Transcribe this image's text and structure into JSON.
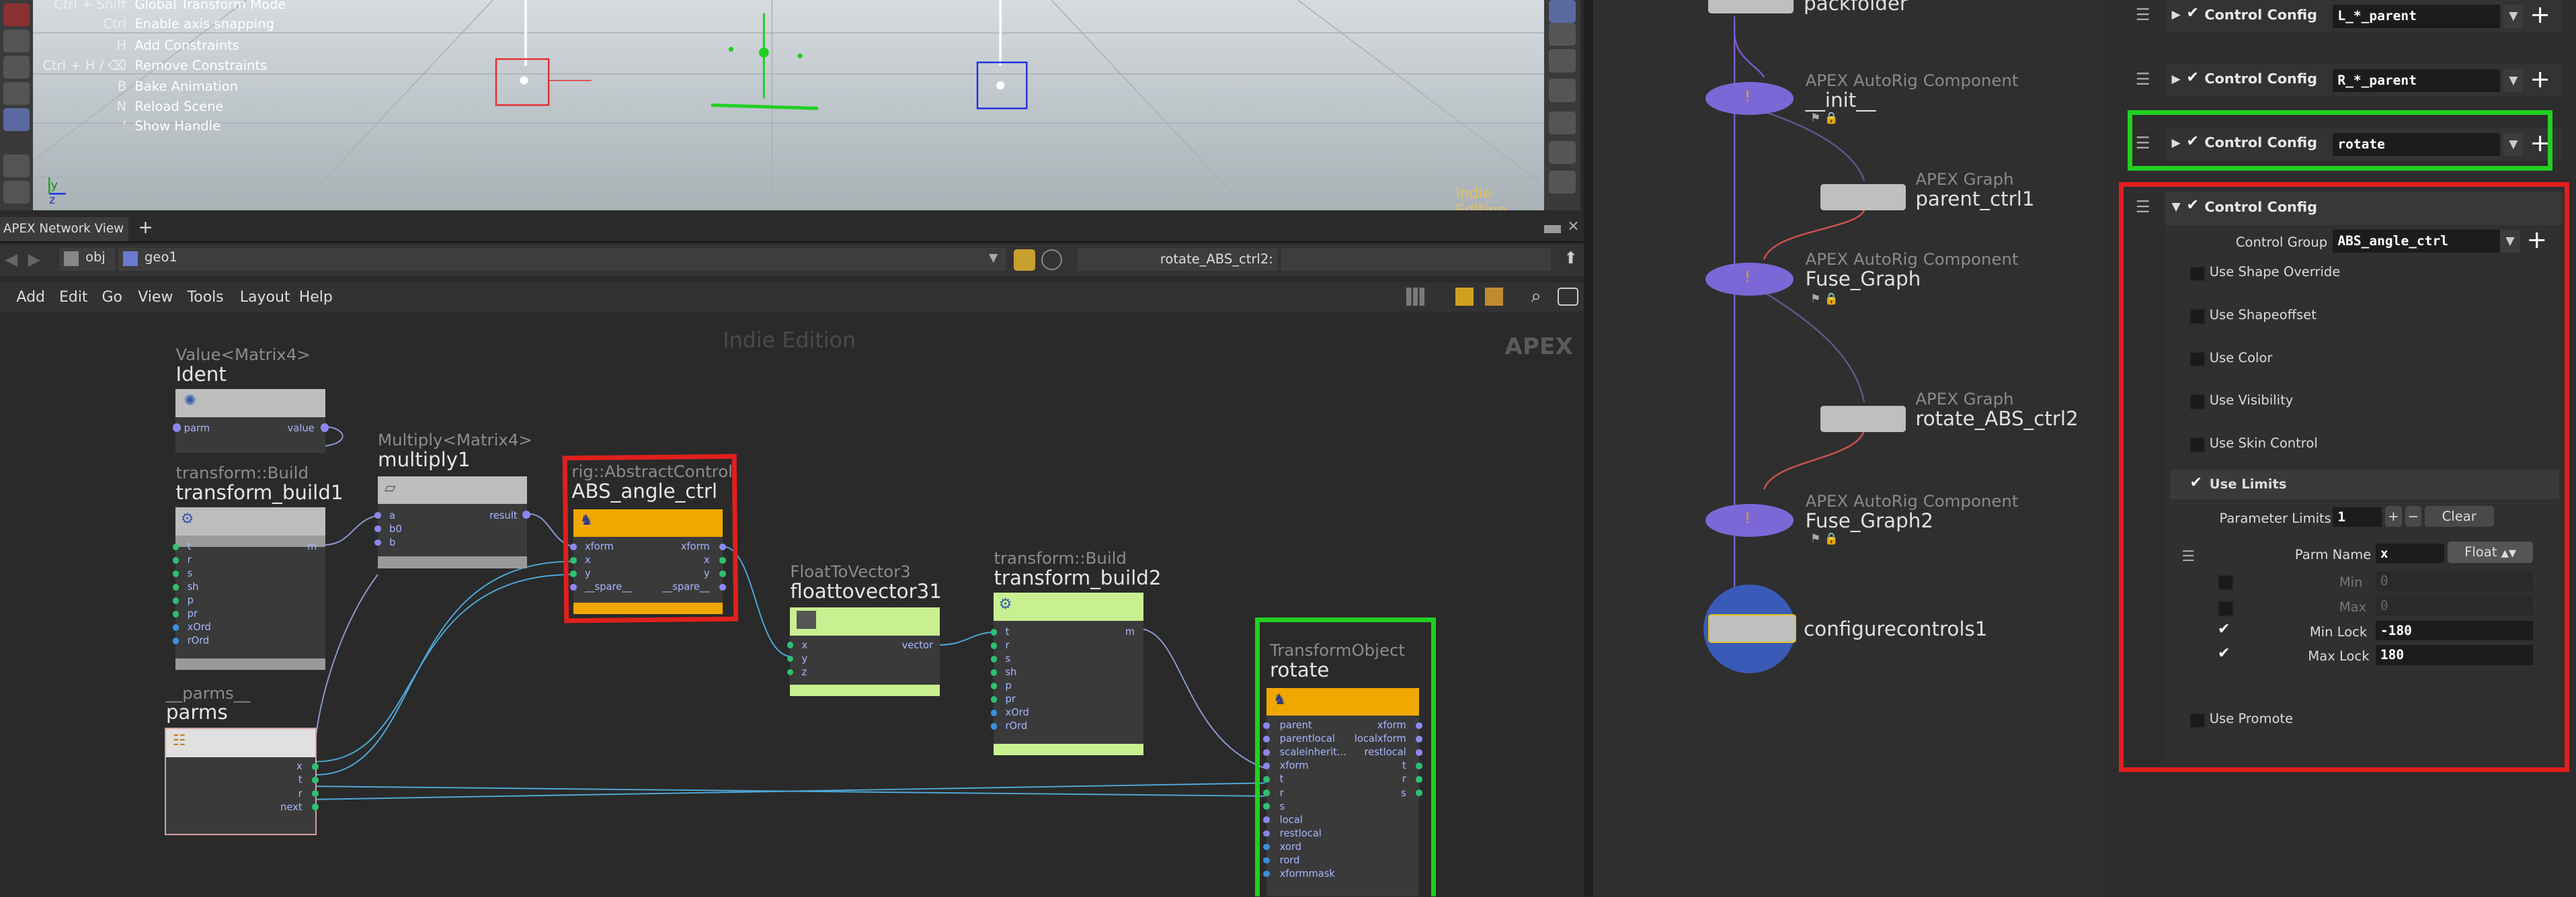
{
  "viewport": {
    "hotkeys": [
      {
        "key": "Ctrl + Shift",
        "action": "Global Transform Mode"
      },
      {
        "key": "Ctrl",
        "action": "Enable axis snapping"
      },
      {
        "key": "H",
        "action": "Add Constraints"
      },
      {
        "key": "Ctrl + H / ⌫",
        "action": "Remove Constraints"
      },
      {
        "key": "B",
        "action": "Bake Animation"
      },
      {
        "key": "N",
        "action": "Reload Scene"
      },
      {
        "key": "'",
        "action": "Show Handle"
      }
    ],
    "watermark": "Indie Edition",
    "axis_labels": {
      "y": "y",
      "z": "z"
    }
  },
  "network": {
    "tab_label": "APEX Network View",
    "add_tab": "+",
    "path": {
      "context": "obj",
      "node": "geo1"
    },
    "search_value": "rotate_ABS_ctrl2:",
    "menu": [
      "Add",
      "Edit",
      "Go",
      "View",
      "Tools",
      "Layout",
      "Help"
    ],
    "watermark": "Indie Edition",
    "apex_label": "APEX",
    "nodes": {
      "ident": {
        "type": "Value<Matrix4>",
        "name": "Ident",
        "ports_in": [
          "parm"
        ],
        "ports_out": [
          "value"
        ]
      },
      "transform_build1": {
        "type": "transform::Build",
        "name": "transform_build1",
        "ports_in": [
          "t",
          "r",
          "s",
          "sh",
          "p",
          "pr",
          "xOrd",
          "rOrd"
        ],
        "ports_out": [
          "m"
        ]
      },
      "multiply1": {
        "type": "Multiply<Matrix4>",
        "name": "multiply1",
        "ports_in": [
          "a",
          "b0",
          "b"
        ],
        "ports_out": [
          "result"
        ]
      },
      "abs_angle_ctrl": {
        "type": "rig::AbstractControl",
        "name": "ABS_angle_ctrl",
        "ports_in": [
          "xform",
          "x",
          "y",
          "__spare__"
        ],
        "ports_out": [
          "xform",
          "x",
          "y",
          "__spare__"
        ]
      },
      "floattovector31": {
        "type": "FloatToVector3",
        "name": "floattovector31",
        "ports_in": [
          "x",
          "y",
          "z"
        ],
        "ports_out": [
          "vector"
        ]
      },
      "transform_build2": {
        "type": "transform::Build",
        "name": "transform_build2",
        "ports_in": [
          "t",
          "r",
          "s",
          "sh",
          "p",
          "pr",
          "xOrd",
          "rOrd"
        ],
        "ports_out": [
          "m"
        ]
      },
      "parms": {
        "type": "__parms__",
        "name": "parms",
        "ports_out": [
          "x",
          "t",
          "r",
          "next"
        ]
      },
      "rotate": {
        "type": "TransformObject",
        "name": "rotate",
        "ports_in": [
          "parent",
          "parentlocal",
          "scaleinherit...",
          "xform",
          "t",
          "r",
          "s",
          "local",
          "restlocal",
          "xord",
          "rord",
          "xformmask"
        ],
        "ports_out": [
          "xform",
          "localxform",
          "restlocal",
          "t",
          "r",
          "s"
        ]
      }
    }
  },
  "network2": {
    "nodes": [
      {
        "title": "",
        "name": "packfolder"
      },
      {
        "title": "APEX AutoRig Component",
        "name": "__init__"
      },
      {
        "title": "APEX Graph",
        "name": "parent_ctrl1"
      },
      {
        "title": "APEX AutoRig Component",
        "name": "Fuse_Graph"
      },
      {
        "title": "APEX Graph",
        "name": "rotate_ABS_ctrl2"
      },
      {
        "title": "APEX AutoRig Component",
        "name": "Fuse_Graph2"
      },
      {
        "title": "",
        "name": "configurecontrols1"
      }
    ]
  },
  "params": {
    "control_configs": [
      {
        "label": "Control Config",
        "value": "L_*_parent"
      },
      {
        "label": "Control Config",
        "value": "R_*_parent"
      },
      {
        "label": "Control Config",
        "value": "rotate"
      }
    ],
    "expanded": {
      "label": "Control Config",
      "control_group_label": "Control Group",
      "control_group_value": "ABS_angle_ctrl",
      "toggles": [
        "Use Shape Override",
        "Use Shapeoffset",
        "Use Color",
        "Use Visibility",
        "Use Skin Control"
      ],
      "use_limits": "Use Limits",
      "parameter_limits_label": "Parameter Limits",
      "parameter_limits_value": "1",
      "clear_button": "Clear",
      "parm_name_label": "Parm Name",
      "parm_name_value": "x",
      "parm_type": "Float",
      "min_label": "Min",
      "min_value": "0",
      "max_label": "Max",
      "max_value": "0",
      "min_lock_label": "Min Lock",
      "min_lock_value": "-180",
      "max_lock_label": "Max Lock",
      "max_lock_value": "180",
      "use_promote": "Use Promote"
    }
  }
}
